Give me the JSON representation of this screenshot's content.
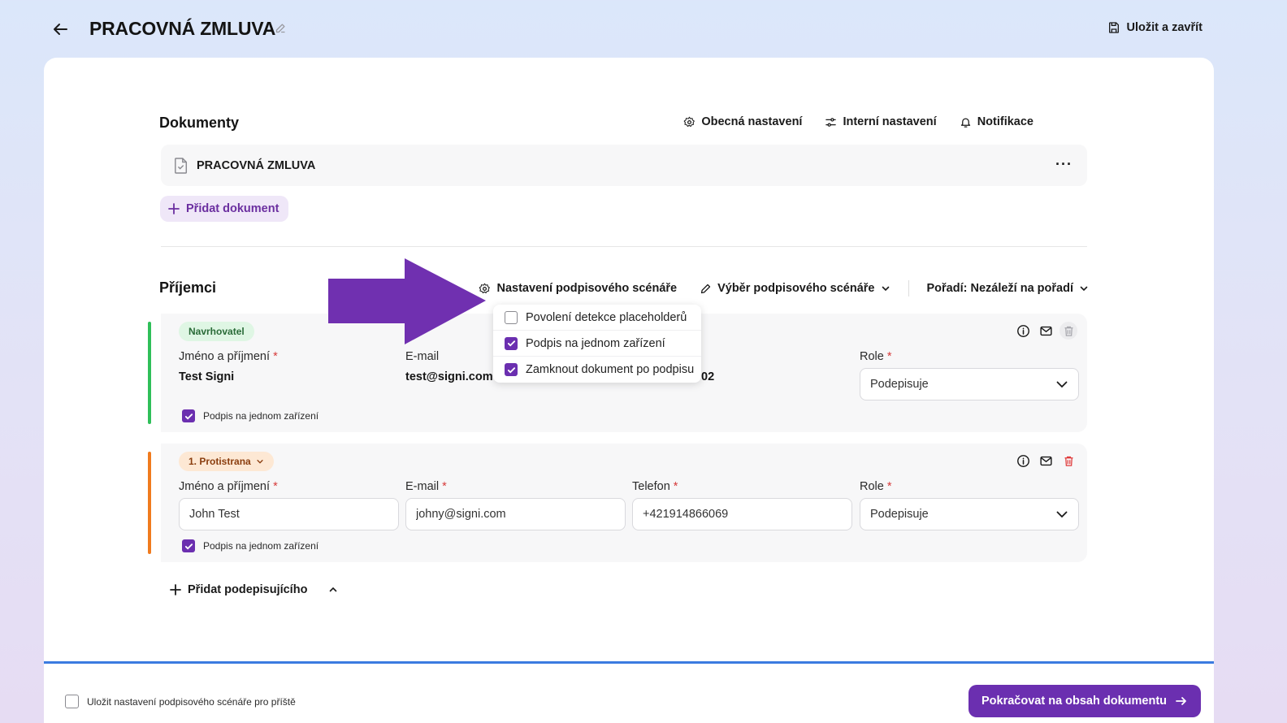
{
  "header": {
    "title": "PRACOVNÁ ZMLUVA",
    "save_close_label": "Uložit a zavřít"
  },
  "documents": {
    "title": "Dokumenty",
    "actions": {
      "general": "Obecná nastavení",
      "internal": "Interní nastavení",
      "notifications": "Notifikace"
    },
    "items": [
      {
        "name": "PRACOVNÁ ZMLUVA"
      }
    ],
    "add_label": "Přidat dokument"
  },
  "recipients": {
    "title": "Příjemci",
    "actions": {
      "scenario_settings": "Nastavení podpisového scénáře",
      "scenario_select": "Výběr podpisového scénáře",
      "order": "Pořadí: Nezáleží na pořadí"
    },
    "labels": {
      "name": "Jméno a příjmení",
      "email": "E-mail",
      "phone": "Telefon",
      "role": "Role",
      "required": "*"
    },
    "list": [
      {
        "badge": "Navrhovatel",
        "name": "Test Signi",
        "email": "test@signi.com",
        "phone_partial": "02",
        "role": "Podepisuje",
        "single_device_label": "Podpis na jednom zařízení"
      },
      {
        "badge": "1. Protistrana",
        "name": "John Test",
        "email": "johny@signi.com",
        "phone": "+421914866069",
        "role": "Podepisuje",
        "single_device_label": "Podpis na jednom zařízení"
      }
    ],
    "add_signer_label": "Přidat podepisujícího"
  },
  "scenario_dropdown": {
    "items": [
      {
        "label": "Povolení detekce placeholderů",
        "checked": false
      },
      {
        "label": "Podpis na jednom zařízení",
        "checked": true
      },
      {
        "label": "Zamknout dokument po podpisu",
        "checked": true
      }
    ]
  },
  "footer": {
    "save_settings_label": "Uložit nastavení podpisového scénáře pro příště",
    "continue_label": "Pokračovat na obsah dokumentu"
  },
  "colors": {
    "accent": "#6b2fb0",
    "arrow": "#7030b0",
    "proposer_bar": "#2fbf59",
    "counterparty_bar": "#f07b1e",
    "footer_line": "#3b7be0",
    "delete": "#e03a3a"
  }
}
